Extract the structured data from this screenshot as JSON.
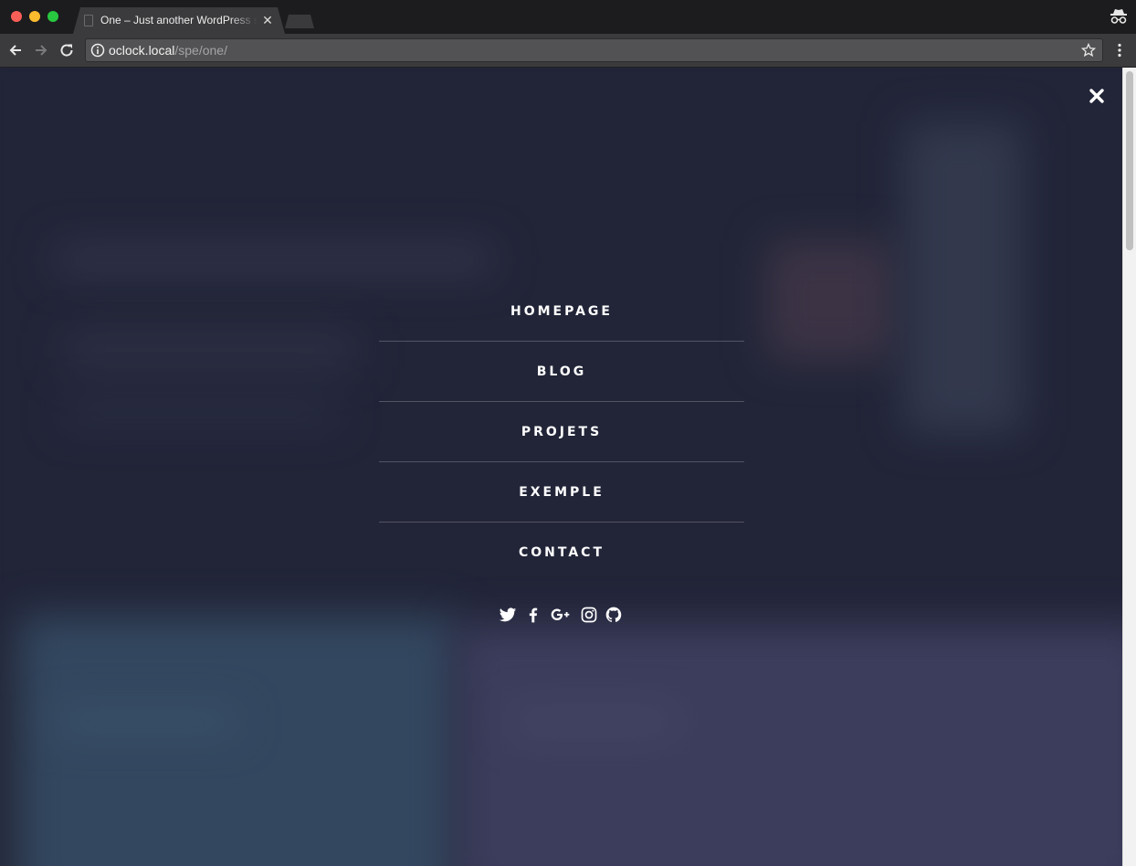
{
  "browser": {
    "tab_title": "One – Just another WordPress site",
    "tab_close": "✕",
    "url_host": "oclock.local",
    "url_path": "/spe/one/"
  },
  "overlay_menu": {
    "items": [
      "HOMEPAGE",
      "BLOG",
      "PROJETS",
      "EXEMPLE",
      "CONTACT"
    ],
    "close_icon": "close-icon"
  },
  "socials": [
    "twitter-icon",
    "facebook-icon",
    "google-plus-icon",
    "instagram-icon",
    "github-icon"
  ],
  "colors": {
    "menu_text": "#ffffff",
    "divider": "rgba(255,255,255,0.22)",
    "page_dark": "#262939",
    "page_teal": "#3c5a74",
    "page_purple": "#4b4a70"
  }
}
